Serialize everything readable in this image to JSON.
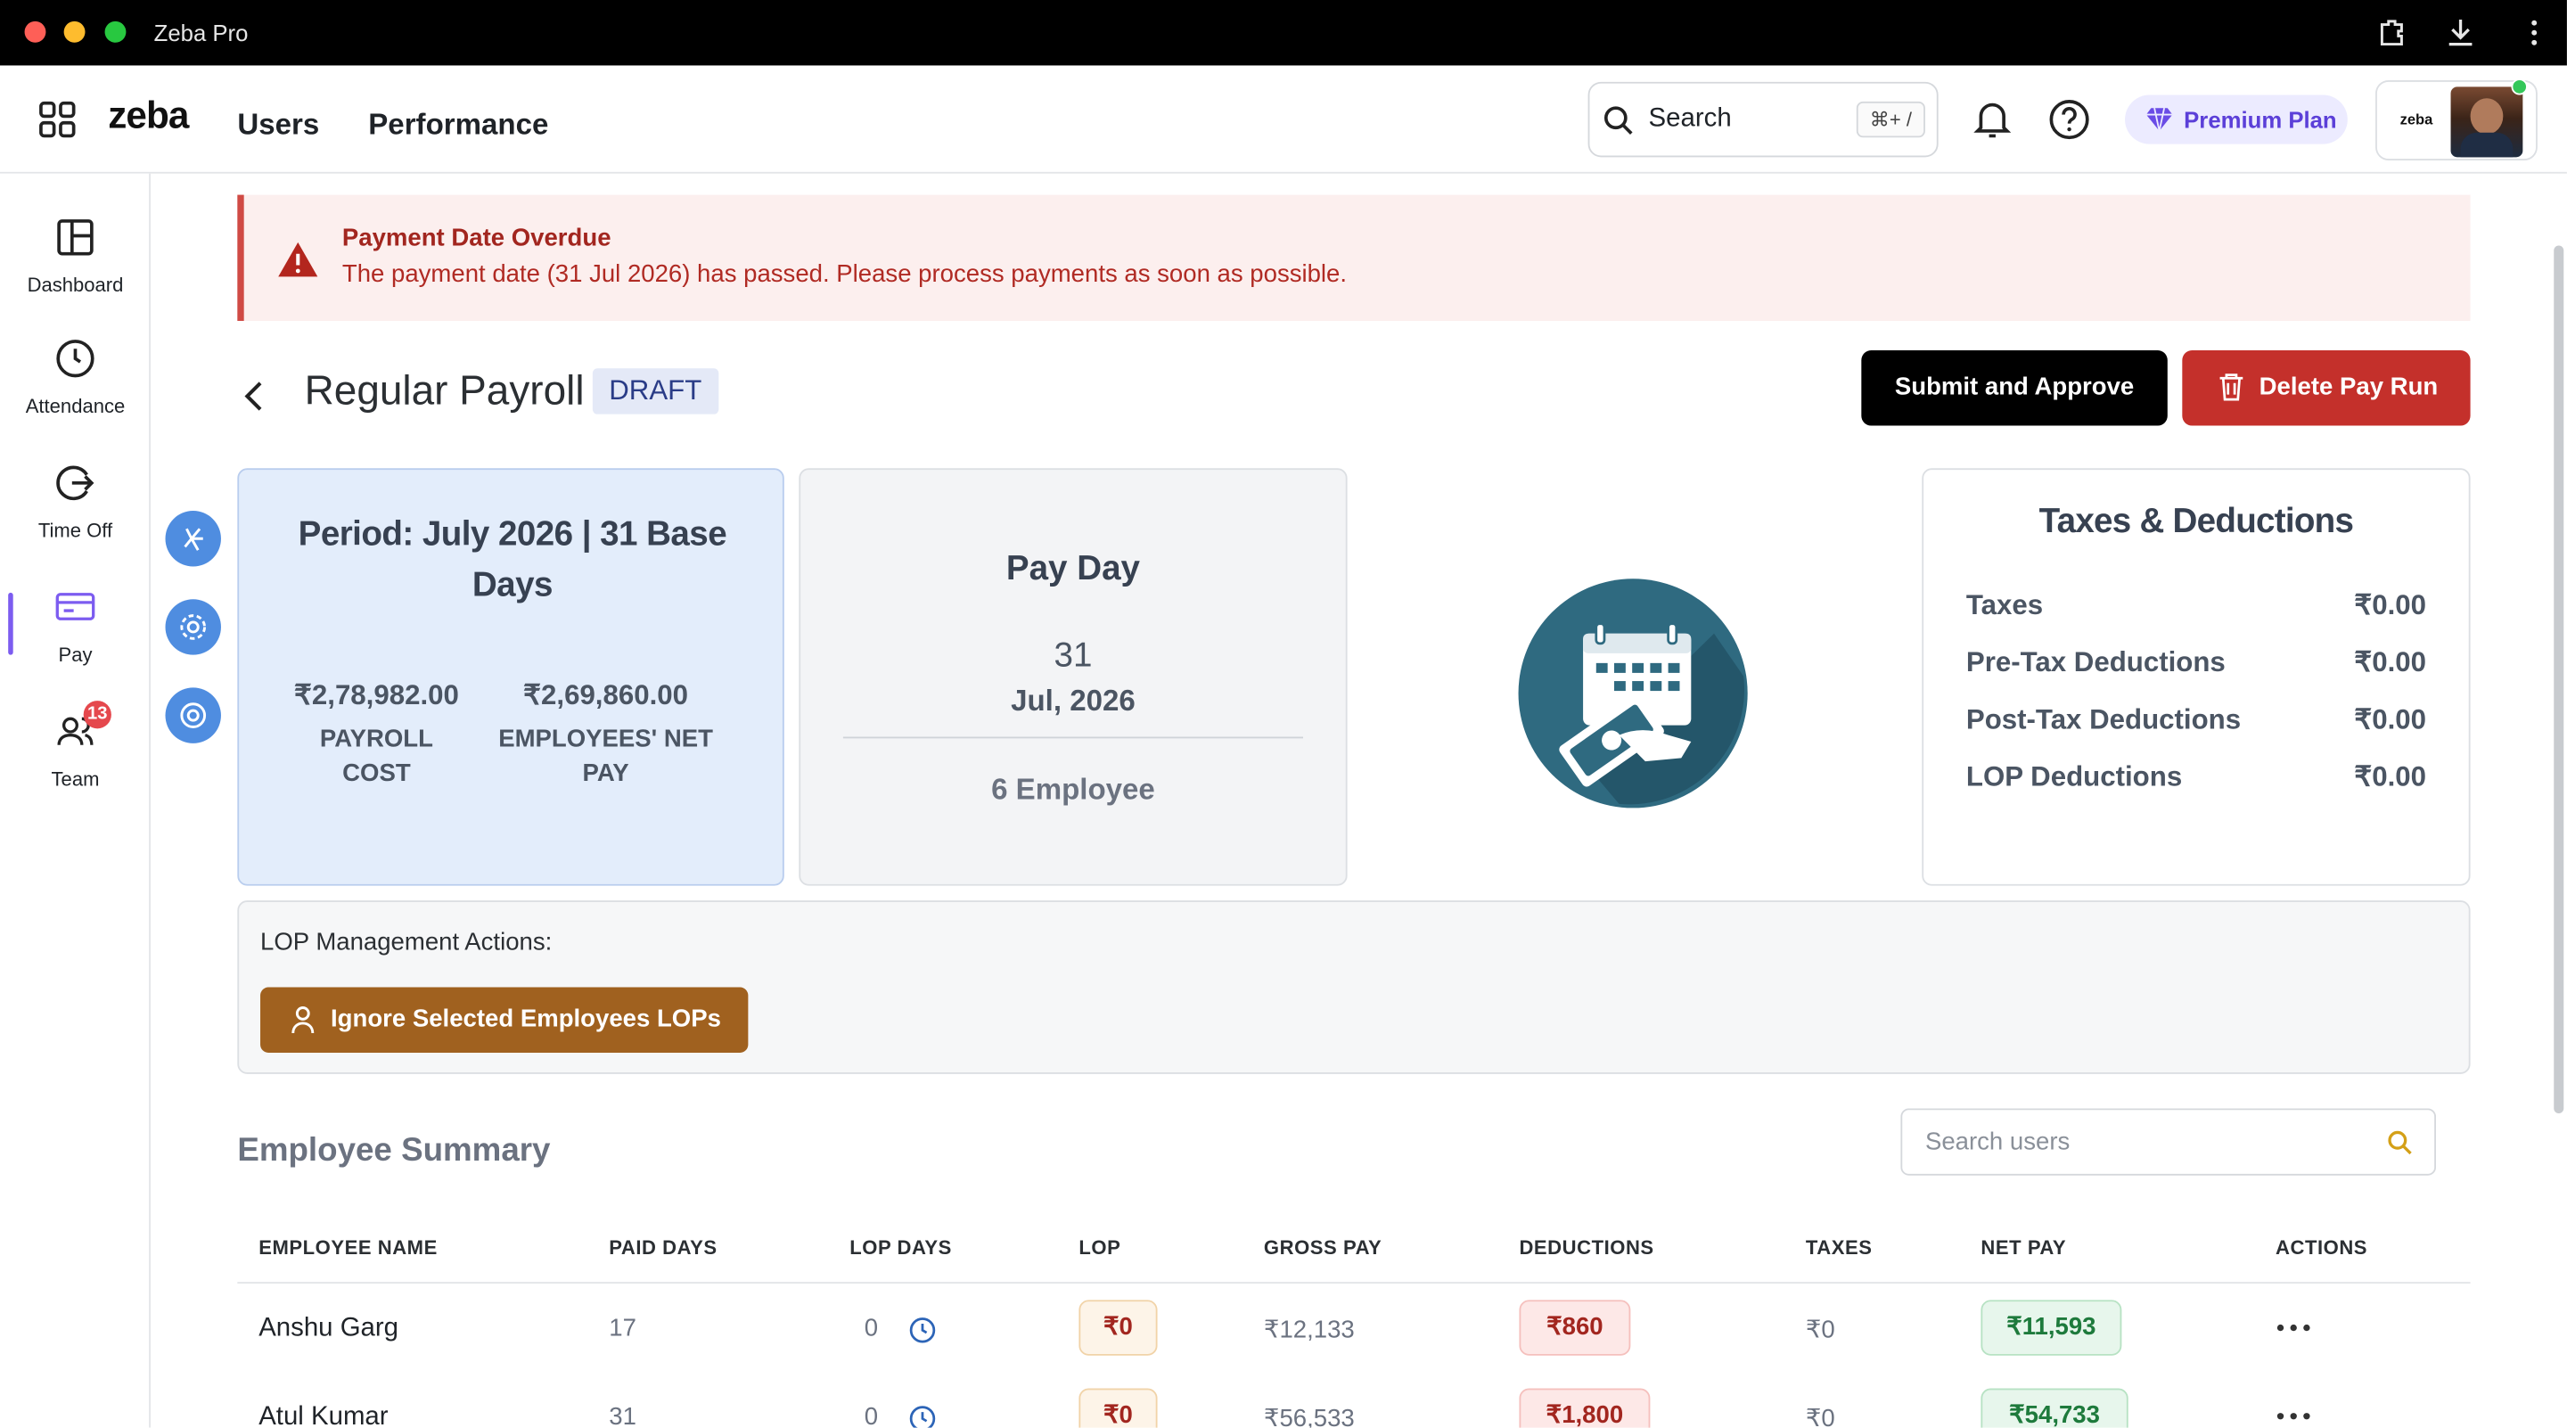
{
  "window": {
    "title": "Zeba Pro"
  },
  "nav": {
    "logo": "zeba",
    "users": "Users",
    "performance": "Performance",
    "search_label": "Search",
    "search_shortcut": "⌘+ /",
    "premium": "Premium Plan",
    "profile_logo": "zeba"
  },
  "sidebar": {
    "items": [
      {
        "label": "Dashboard"
      },
      {
        "label": "Attendance"
      },
      {
        "label": "Time Off"
      },
      {
        "label": "Pay"
      },
      {
        "label": "Team",
        "badge": "13"
      }
    ]
  },
  "alert": {
    "title": "Payment Date Overdue",
    "message": "The payment date (31 Jul 2026) has passed. Please process payments as soon as possible."
  },
  "header": {
    "title": "Regular Payroll",
    "status": "DRAFT",
    "submit": "Submit and Approve",
    "delete": "Delete Pay Run"
  },
  "period": {
    "title": "Period: July 2026 | 31 Base Days",
    "payroll_cost": "₹2,78,982.00",
    "payroll_cost_label": "PAYROLL COST",
    "net_pay": "₹2,69,860.00",
    "net_pay_label": "EMPLOYEES' NET PAY"
  },
  "payday": {
    "title": "Pay Day",
    "day": "31",
    "month_year": "Jul, 2026",
    "employees": "6 Employee"
  },
  "taxes": {
    "title": "Taxes & Deductions",
    "rows": [
      {
        "label": "Taxes",
        "value": "₹0.00"
      },
      {
        "label": "Pre-Tax Deductions",
        "value": "₹0.00"
      },
      {
        "label": "Post-Tax Deductions",
        "value": "₹0.00"
      },
      {
        "label": "LOP Deductions",
        "value": "₹0.00"
      }
    ]
  },
  "lop": {
    "title": "LOP Management Actions:",
    "button": "Ignore Selected Employees LOPs"
  },
  "summary": {
    "title": "Employee Summary",
    "search_placeholder": "Search users"
  },
  "table": {
    "headers": [
      "EMPLOYEE NAME",
      "PAID DAYS",
      "LOP DAYS",
      "LOP",
      "GROSS PAY",
      "DEDUCTIONS",
      "TAXES",
      "NET PAY",
      "ACTIONS"
    ],
    "rows": [
      {
        "name": "Anshu Garg",
        "paid_days": "17",
        "lop_days": "0",
        "lop": "₹0",
        "gross": "₹12,133",
        "deductions": "₹860",
        "taxes": "₹0",
        "net": "₹11,593"
      },
      {
        "name": "Atul Kumar",
        "paid_days": "31",
        "lop_days": "0",
        "lop": "₹0",
        "gross": "₹56,533",
        "deductions": "₹1,800",
        "taxes": "₹0",
        "net": "₹54,733"
      }
    ]
  },
  "colors": {
    "accent": "#5b3fd8",
    "danger": "#c4302b",
    "lop_button": "#a0611f",
    "period_card": "#e3edfb"
  }
}
